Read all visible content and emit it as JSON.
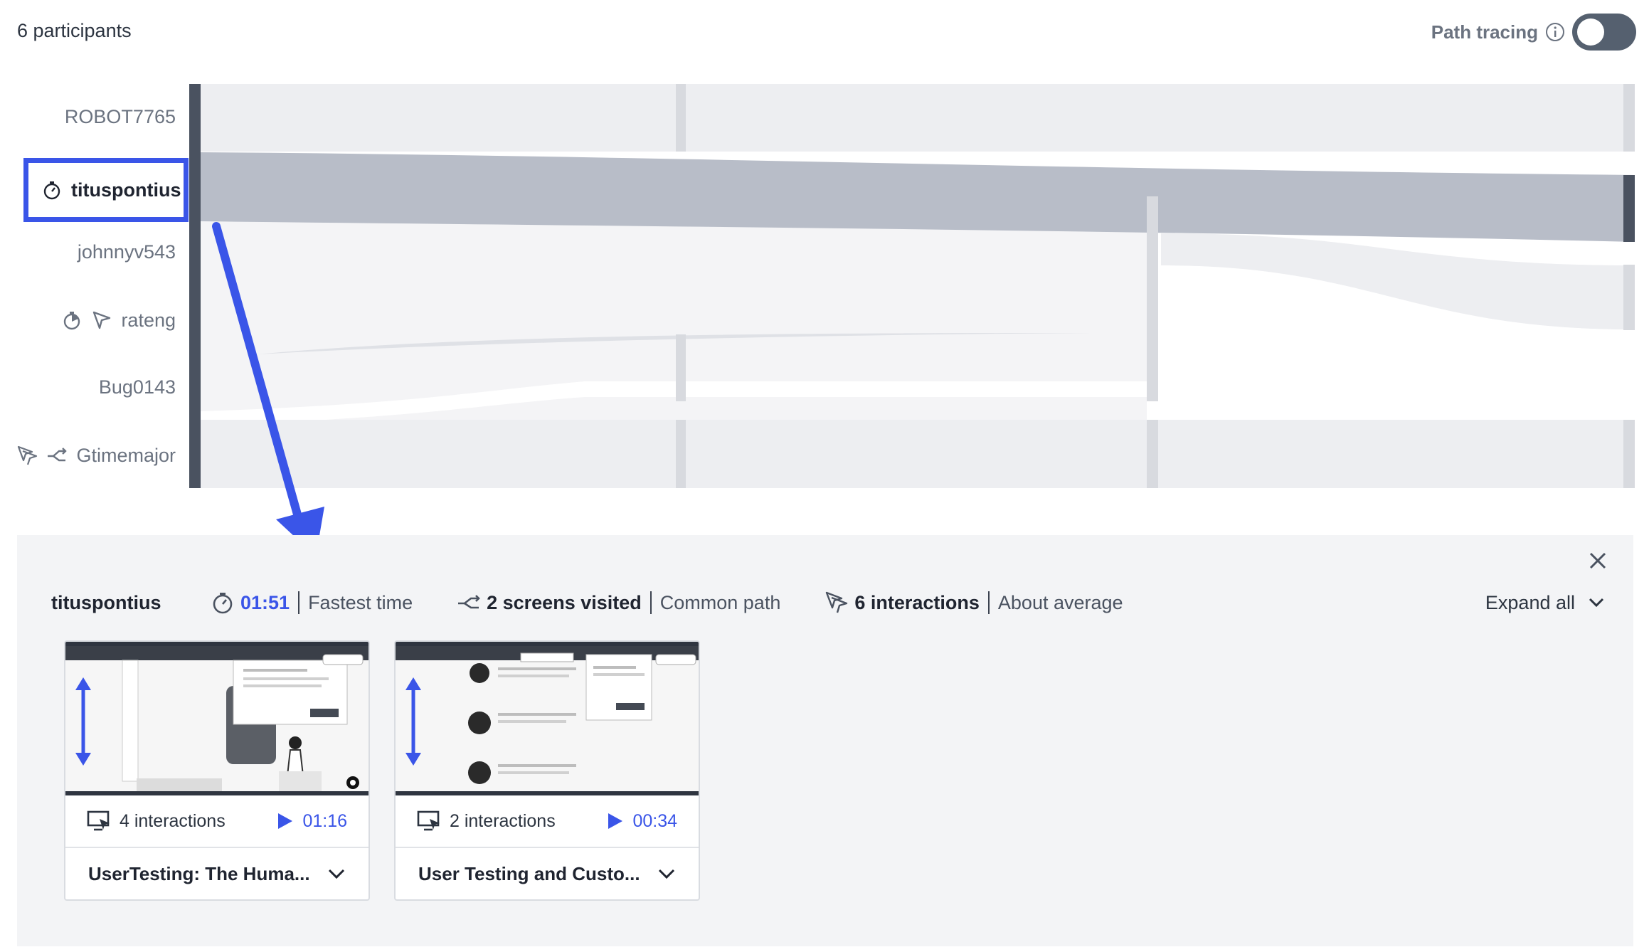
{
  "header": {
    "participants_count": "6 participants",
    "path_tracing_label": "Path tracing",
    "path_tracing_enabled": false
  },
  "participants": [
    {
      "name": "ROBOT7765",
      "icons": []
    },
    {
      "name": "tituspontius",
      "icons": [
        "stopwatch-icon"
      ],
      "selected": true
    },
    {
      "name": "johnnyv543",
      "icons": []
    },
    {
      "name": "rateng",
      "icons": [
        "stopwatch-icon",
        "pointer-icon"
      ]
    },
    {
      "name": "Bug0143",
      "icons": []
    },
    {
      "name": "Gtimemajor",
      "icons": [
        "multi-pointer-icon",
        "path-icon"
      ]
    }
  ],
  "detail": {
    "participant": "tituspontius",
    "time": {
      "value": "01:51",
      "label": "Fastest time"
    },
    "screens": {
      "value": "2 screens visited",
      "label": "Common path"
    },
    "interactions": {
      "value": "6 interactions",
      "label": "About average"
    },
    "expand_label": "Expand all",
    "cards": [
      {
        "interactions": "4 interactions",
        "duration": "01:16",
        "title": "UserTesting: The Huma..."
      },
      {
        "interactions": "2 interactions",
        "duration": "00:34",
        "title": "User Testing and Custo..."
      }
    ]
  },
  "colors": {
    "accent": "#3a55e8",
    "selected_flow": "#b8bdc8",
    "flow": "#edeef1",
    "axis": "#4a5260"
  }
}
